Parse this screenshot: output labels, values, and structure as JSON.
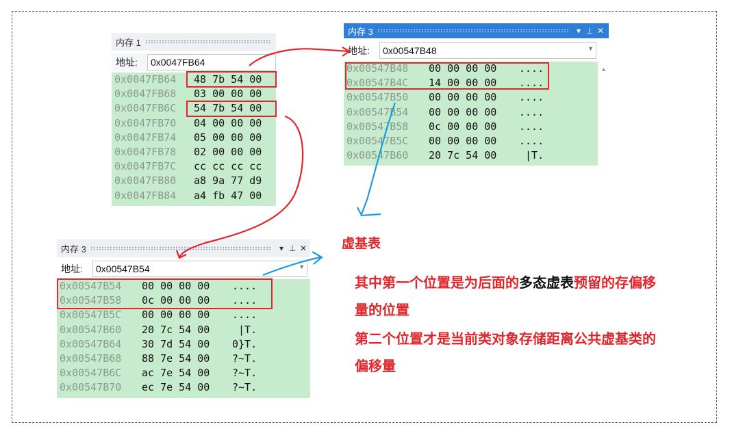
{
  "memory1": {
    "title": "内存 1",
    "address_label": "地址:",
    "address_value": "0x0047FB64",
    "rows": [
      {
        "addr": "0x0047FB64",
        "bytes": "48 7b 54 00",
        "chars": ""
      },
      {
        "addr": "0x0047FB68",
        "bytes": "03 00 00 00",
        "chars": ""
      },
      {
        "addr": "0x0047FB6C",
        "bytes": "54 7b 54 00",
        "chars": ""
      },
      {
        "addr": "0x0047FB70",
        "bytes": "04 00 00 00",
        "chars": ""
      },
      {
        "addr": "0x0047FB74",
        "bytes": "05 00 00 00",
        "chars": ""
      },
      {
        "addr": "0x0047FB78",
        "bytes": "02 00 00 00",
        "chars": ""
      },
      {
        "addr": "0x0047FB7C",
        "bytes": "cc cc cc cc",
        "chars": ""
      },
      {
        "addr": "0x0047FB80",
        "bytes": "a8 9a 77 d9",
        "chars": ""
      },
      {
        "addr": "0x0047FB84",
        "bytes": "a4 fb 47 00",
        "chars": ""
      }
    ]
  },
  "memory3_top": {
    "title": "内存 3",
    "address_label": "地址:",
    "address_value": "0x00547B48",
    "rows": [
      {
        "addr": "0x00547B48",
        "bytes": "00 00 00 00",
        "chars": "...."
      },
      {
        "addr": "0x00547B4C",
        "bytes": "14 00 00 00",
        "chars": "...."
      },
      {
        "addr": "0x00547B50",
        "bytes": "00 00 00 00",
        "chars": "...."
      },
      {
        "addr": "0x00547B54",
        "bytes": "00 00 00 00",
        "chars": "...."
      },
      {
        "addr": "0x00547B58",
        "bytes": "0c 00 00 00",
        "chars": "...."
      },
      {
        "addr": "0x00547B5C",
        "bytes": "00 00 00 00",
        "chars": "...."
      },
      {
        "addr": "0x00547B60",
        "bytes": "20 7c 54 00",
        "chars": " |T."
      }
    ]
  },
  "memory3_bottom": {
    "title": "内存 3",
    "address_label": "地址:",
    "address_value": "0x00547B54",
    "rows": [
      {
        "addr": "0x00547B54",
        "bytes": "00 00 00 00",
        "chars": "...."
      },
      {
        "addr": "0x00547B58",
        "bytes": "0c 00 00 00",
        "chars": "...."
      },
      {
        "addr": "0x00547B5C",
        "bytes": "00 00 00 00",
        "chars": "...."
      },
      {
        "addr": "0x00547B60",
        "bytes": "20 7c 54 00",
        "chars": " |T."
      },
      {
        "addr": "0x00547B64",
        "bytes": "30 7d 54 00",
        "chars": "0}T."
      },
      {
        "addr": "0x00547B68",
        "bytes": "88 7e 54 00",
        "chars": "?~T."
      },
      {
        "addr": "0x00547B6C",
        "bytes": "ac 7e 54 00",
        "chars": "?~T."
      },
      {
        "addr": "0x00547B70",
        "bytes": "ec 7e 54 00",
        "chars": "?~T."
      }
    ]
  },
  "annotations": {
    "vbase_label": "虚基表",
    "line1_a": "其中第一个位置是为后面的",
    "line1_b": "多态虚表",
    "line1_c": "预留的存偏移",
    "line2": "量的位置",
    "line3": "第二个位置才是当前类对象存储距离公共虚基类的",
    "line4": "偏移量"
  },
  "colors": {
    "highlight_red": "#e0262b",
    "arrow_blue": "#1a9be0",
    "memory_green": "#c7ebcd",
    "active_title": "#2f7ed8"
  }
}
